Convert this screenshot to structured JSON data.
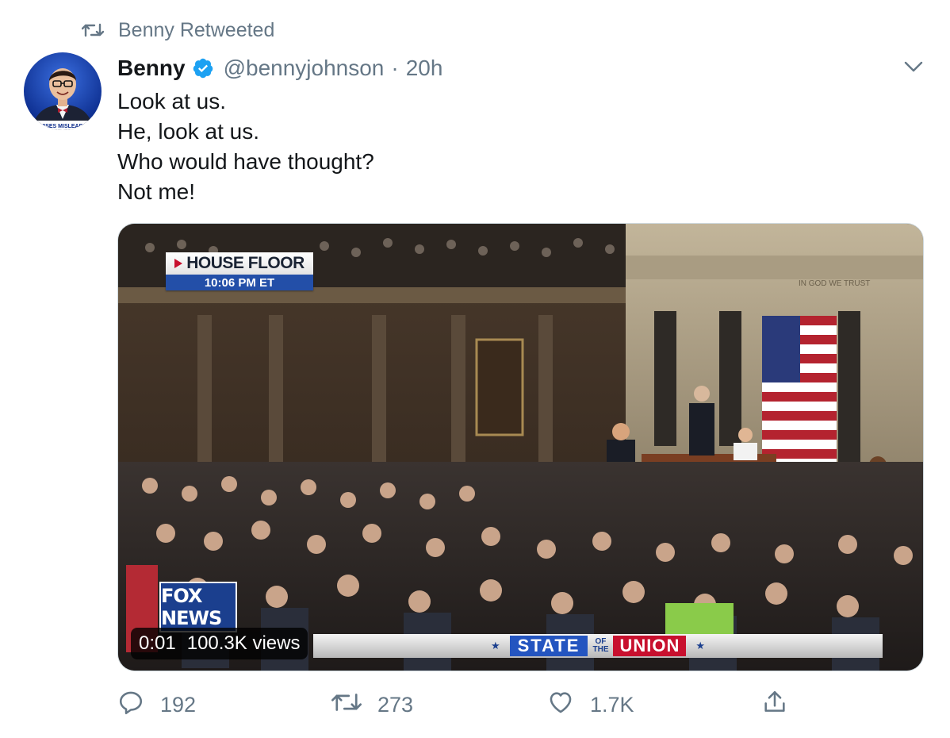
{
  "retweet_context": {
    "text": "Benny Retweeted"
  },
  "tweet": {
    "author_name": "Benny",
    "handle": "@bennyjohnson",
    "separator": "·",
    "time": "20h",
    "verified": true,
    "text_lines": [
      "Look at us.",
      "He, look at us.",
      "Who would have thought?",
      "Not me!"
    ],
    "avatar_caption": "DEVISES MISLEADING"
  },
  "media": {
    "type": "video",
    "chyron": {
      "title": "HOUSE FLOOR",
      "time": "10:06 PM ET"
    },
    "network_logo": "FOX NEWS",
    "banner": {
      "left_word": "STATE",
      "connector_top": "OF",
      "connector_bottom": "THE",
      "right_word": "UNION"
    },
    "flag_inscription": "IN GOD WE TRUST",
    "playback_time": "0:01",
    "views": "100.3K views"
  },
  "actions": {
    "reply_count": "192",
    "retweet_count": "273",
    "like_count": "1.7K"
  },
  "colors": {
    "text_primary": "#14171a",
    "text_secondary": "#657786",
    "verified_blue": "#1da1f2",
    "fox_blue": "#1b3f8e",
    "union_red": "#c8102e"
  }
}
